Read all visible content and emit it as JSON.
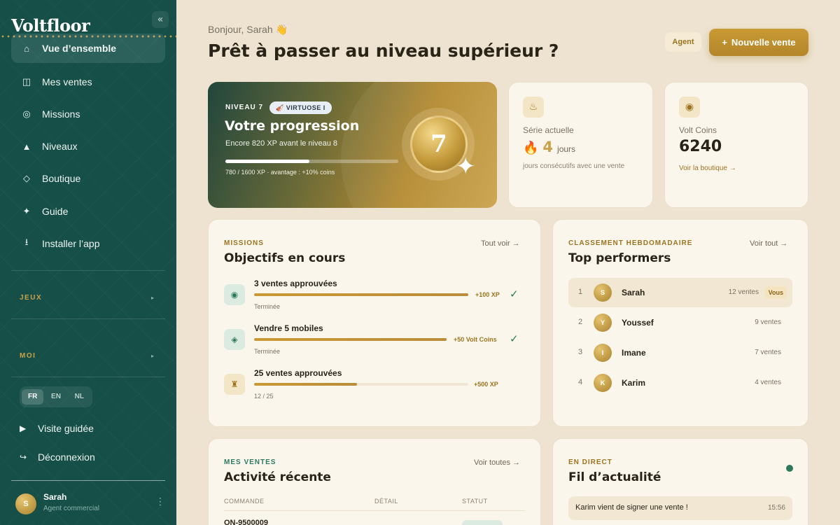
{
  "app": {
    "logo": "Voltfloor",
    "collapse_icon": "«"
  },
  "sidebar": {
    "nav": [
      {
        "label": "Vue d’ensemble",
        "icon": "home-icon",
        "glyph": "⌂",
        "active": true
      },
      {
        "label": "Mes ventes",
        "icon": "book-icon",
        "glyph": "◫"
      },
      {
        "label": "Missions",
        "icon": "target-icon",
        "glyph": "◎"
      },
      {
        "label": "Niveaux",
        "icon": "triangle-icon",
        "glyph": "▲"
      },
      {
        "label": "Boutique",
        "icon": "diamond-icon",
        "glyph": "◇"
      },
      {
        "label": "Guide",
        "icon": "sparkle-icon",
        "glyph": "✦"
      },
      {
        "label": "Installer l’app",
        "icon": "download-icon",
        "glyph": "⭳"
      }
    ],
    "sections": [
      {
        "label": "JEUX"
      },
      {
        "label": "MOI"
      }
    ],
    "languages": [
      {
        "code": "FR",
        "selected": true
      },
      {
        "code": "EN"
      },
      {
        "code": "NL"
      }
    ],
    "tour_label": "Visite guidée",
    "logout_label": "Déconnexion",
    "user": {
      "initial": "S",
      "name": "Sarah",
      "role": "Agent commercial"
    }
  },
  "header": {
    "greeting": "Bonjour, Sarah 👋",
    "title": "Prêt à passer au niveau supérieur ?",
    "role_badge": "Agent",
    "new_sale_label": "Nouvelle vente",
    "new_sale_icon": "+"
  },
  "progress": {
    "level_label": "NIVEAU 7",
    "rank_badge": "VIRTUOSE I",
    "title": "Votre progression",
    "subtitle": "Encore 820 XP avant le niveau 8",
    "xp_text": "780 / 1600 XP · avantage : +10% coins",
    "xp_current": 780,
    "xp_max": 1600,
    "level": "7"
  },
  "streak": {
    "label": "Série actuelle",
    "value": "4",
    "unit": "jours",
    "note": "jours consécutifs avec une vente",
    "icon": "cake-icon",
    "glyph": "♨"
  },
  "coins": {
    "label": "Volt Coins",
    "value": "6240",
    "link": "Voir la boutique →",
    "icon": "coin-icon",
    "glyph": "◉"
  },
  "missions": {
    "eyebrow": "MISSIONS",
    "title": "Objectifs en cours",
    "link": "Tout voir →",
    "items": [
      {
        "title": "3 ventes approuvées",
        "status": "Terminée",
        "reward": "+100 XP",
        "progress": 1.0,
        "done": true,
        "icon": "target-icon",
        "glyph": "◉",
        "tone": "green"
      },
      {
        "title": "Vendre 5 mobiles",
        "status": "Terminée",
        "reward": "+50 Volt Coins",
        "progress": 1.0,
        "done": true,
        "icon": "gem-icon",
        "glyph": "◈",
        "tone": "green"
      },
      {
        "title": "25 ventes approuvées",
        "status": "12 / 25",
        "reward": "+500 XP",
        "progress": 0.48,
        "done": false,
        "icon": "rook-icon",
        "glyph": "♜",
        "tone": "gold"
      }
    ]
  },
  "leaderboard": {
    "eyebrow": "CLASSEMENT HEBDOMADAIRE",
    "title": "Top performers",
    "link": "Voir tout →",
    "you_label": "Vous",
    "rows": [
      {
        "rank": "1",
        "initial": "S",
        "name": "Sarah",
        "count": "12 ventes",
        "me": true
      },
      {
        "rank": "2",
        "initial": "Y",
        "name": "Youssef",
        "count": "9 ventes"
      },
      {
        "rank": "3",
        "initial": "I",
        "name": "Imane",
        "count": "7 ventes"
      },
      {
        "rank": "4",
        "initial": "K",
        "name": "Karim",
        "count": "4 ventes"
      }
    ]
  },
  "sales": {
    "eyebrow": "MES VENTES",
    "title": "Activité récente",
    "link": "Voir toutes →",
    "columns": [
      "COMMANDE",
      "DÉTAIL",
      "STATUT"
    ],
    "rows": [
      {
        "order": "ON-9500009"
      }
    ]
  },
  "feed": {
    "eyebrow": "EN DIRECT",
    "title": "Fil d’actualité",
    "items": [
      {
        "text": "Karim vient de signer une vente !",
        "time": "15:56"
      }
    ]
  }
}
